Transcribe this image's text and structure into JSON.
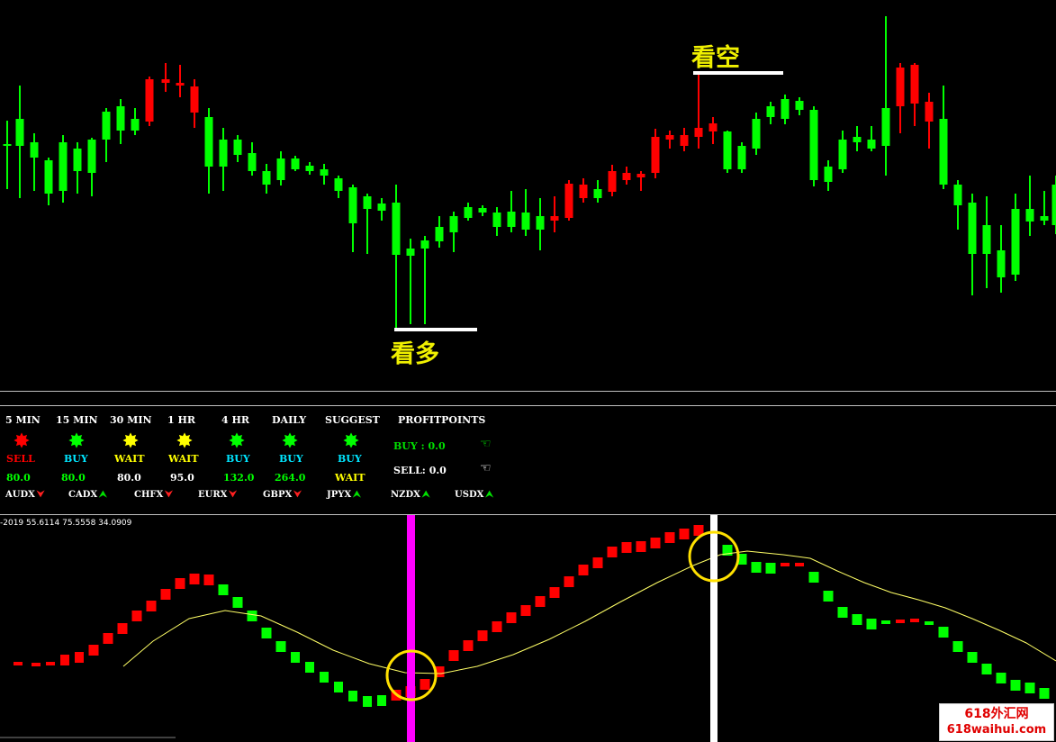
{
  "main_chart": {
    "annotations": {
      "bearish": "看空",
      "bullish": "看多"
    },
    "colors": {
      "bull": "#00ff00",
      "bear": "#ff0000",
      "background": "#000000",
      "marker_line": "#ffffff",
      "label": "#f0f000"
    }
  },
  "dashboard": {
    "timeframes": [
      {
        "label": "5 MIN",
        "signal": "SELL",
        "value": "80.0",
        "dot": "#ff0000",
        "signal_color": "#ff0000"
      },
      {
        "label": "15 MIN",
        "signal": "BUY",
        "value": "80.0",
        "dot": "#00ff00",
        "signal_color": "#00e5ff"
      },
      {
        "label": "30 MIN",
        "signal": "WAIT",
        "value": "80.0",
        "dot": "#ffff00",
        "signal_color": "#ffff00"
      },
      {
        "label": "1 HR",
        "signal": "WAIT",
        "value": "95.0",
        "dot": "#ffff00",
        "signal_color": "#ffff00"
      },
      {
        "label": "4 HR",
        "signal": "BUY",
        "value": "132.0",
        "dot": "#00ff00",
        "signal_color": "#00e5ff"
      },
      {
        "label": "DAILY",
        "signal": "BUY",
        "value": "264.0",
        "dot": "#00ff00",
        "signal_color": "#00e5ff"
      },
      {
        "label": "SUGGEST",
        "signal": "BUY",
        "value": "WAIT",
        "dot": "#00ff00",
        "signal_color": "#00e5ff"
      }
    ],
    "value_colors": {
      "default": "#00ff00",
      "1 HR": "#ffffff",
      "SUGGEST": "#ffff00"
    },
    "profitpoints": {
      "title": "PROFITPOINTS",
      "buy_label": "BUY :",
      "buy_value": "0.0",
      "sell_label": "SELL:",
      "sell_value": "0.0"
    },
    "currencies": [
      {
        "name": "AUDX",
        "direction": "down"
      },
      {
        "name": "CADX",
        "direction": "up"
      },
      {
        "name": "CHFX",
        "direction": "down"
      },
      {
        "name": "EURX",
        "direction": "down"
      },
      {
        "name": "GBPX",
        "direction": "down"
      },
      {
        "name": "JPYX",
        "direction": "up"
      },
      {
        "name": "NZDX",
        "direction": "up"
      },
      {
        "name": "USDX",
        "direction": "up"
      }
    ]
  },
  "oscillator": {
    "info": "-2019 55.6114 75.5558 34.0909",
    "colors": {
      "up": "#ff0000",
      "down": "#00ff00",
      "signal_line": "#ffff66",
      "vline_1": "#ff00ff",
      "vline_2": "#ffffff",
      "circle": "#ffe000"
    }
  },
  "watermark": {
    "line1": "618外汇网",
    "line2": "618waihui.com"
  }
}
